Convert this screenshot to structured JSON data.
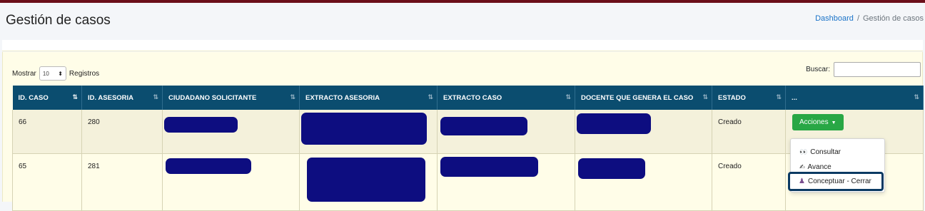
{
  "header": {
    "title": "Gestión de casos",
    "breadcrumb": {
      "link": "Dashboard",
      "separator": "/",
      "current": "Gestión de casos"
    }
  },
  "controls": {
    "show_label": "Mostrar",
    "page_length": "10",
    "records_label": "Registros",
    "search_label": "Buscar:",
    "search_value": ""
  },
  "table": {
    "columns": [
      "ID. CASO",
      "ID. ASESORIA",
      "CIUDADANO SOLICITANTE",
      "EXTRACTO ASESORIA",
      "EXTRACTO CASO",
      "DOCENTE QUE GENERA EL CASO",
      "ESTADO",
      "..."
    ],
    "rows": [
      {
        "id_caso": "66",
        "id_asesoria": "280",
        "estado": "Creado",
        "action_label": "Acciones"
      },
      {
        "id_caso": "65",
        "id_asesoria": "281",
        "estado": "Creado"
      }
    ]
  },
  "dropdown": {
    "items": [
      {
        "label": "Consultar",
        "icon": "eyes-icon"
      },
      {
        "label": "Avance",
        "icon": "writing-hand-icon"
      },
      {
        "label": "Conceptuar - Cerrar",
        "icon": "person-icon"
      }
    ]
  },
  "colors": {
    "topbar": "#6b0f1a",
    "table_header": "#0b4d6f",
    "redaction": "#0d0d80",
    "action_button": "#28a745",
    "focus_border": "#0b3a63"
  }
}
